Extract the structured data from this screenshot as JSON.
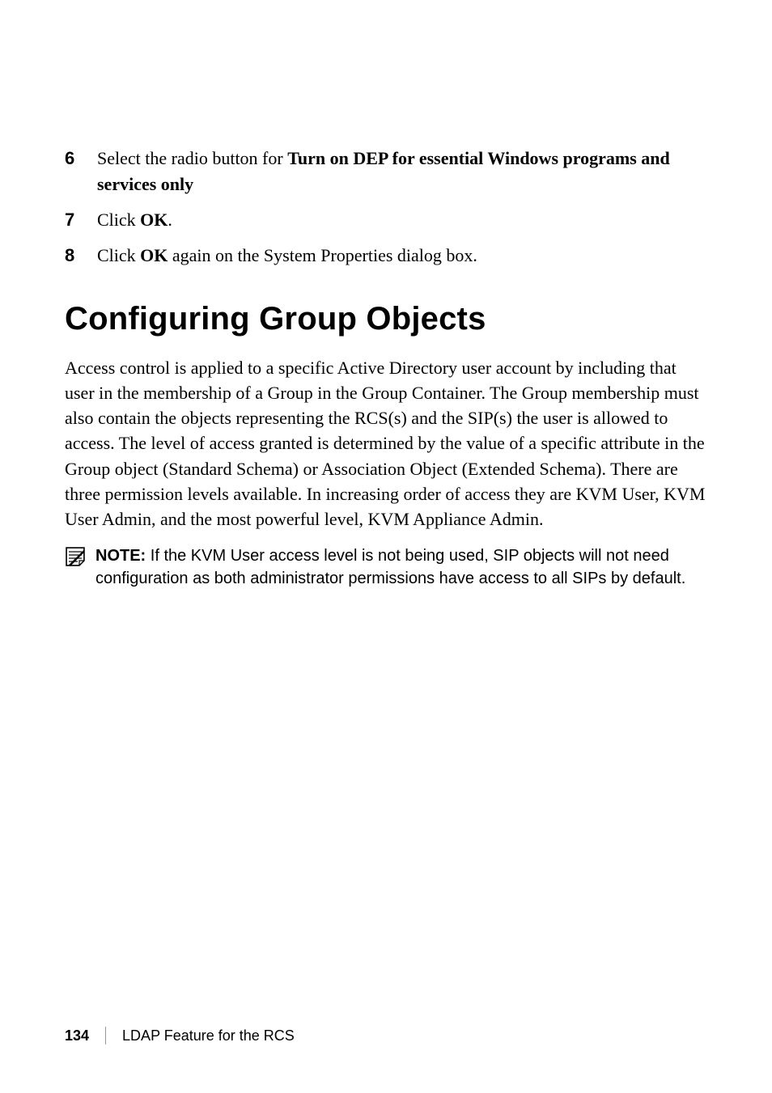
{
  "steps": [
    {
      "number": "6",
      "pre": "Select the radio button for ",
      "bold1": "Turn on DEP for essential Windows programs and services only",
      "post": ""
    },
    {
      "number": "7",
      "pre": "Click ",
      "bold1": "OK",
      "post": "."
    },
    {
      "number": "8",
      "pre": "Click ",
      "bold1": "OK",
      "post": " again on the System Properties dialog box."
    }
  ],
  "heading": "Configuring Group Objects",
  "paragraph": "Access control is applied to a specific Active Directory user account by including that user in the membership of a Group in the Group Container. The Group membership must also contain the objects representing the RCS(s) and the SIP(s) the user is allowed to access. The level of access granted is determined by the value of a specific attribute in the Group object (Standard Schema) or Association Object (Extended Schema). There are three permission levels available. In increasing order of access they are KVM User, KVM User Admin, and the most powerful level, KVM Appliance Admin.",
  "note": {
    "label": "NOTE:",
    "text": " If the KVM User access level is not being used, SIP objects will not need configuration as both administrator permissions have access to all SIPs by default."
  },
  "footer": {
    "page": "134",
    "section": "LDAP Feature for the RCS"
  }
}
